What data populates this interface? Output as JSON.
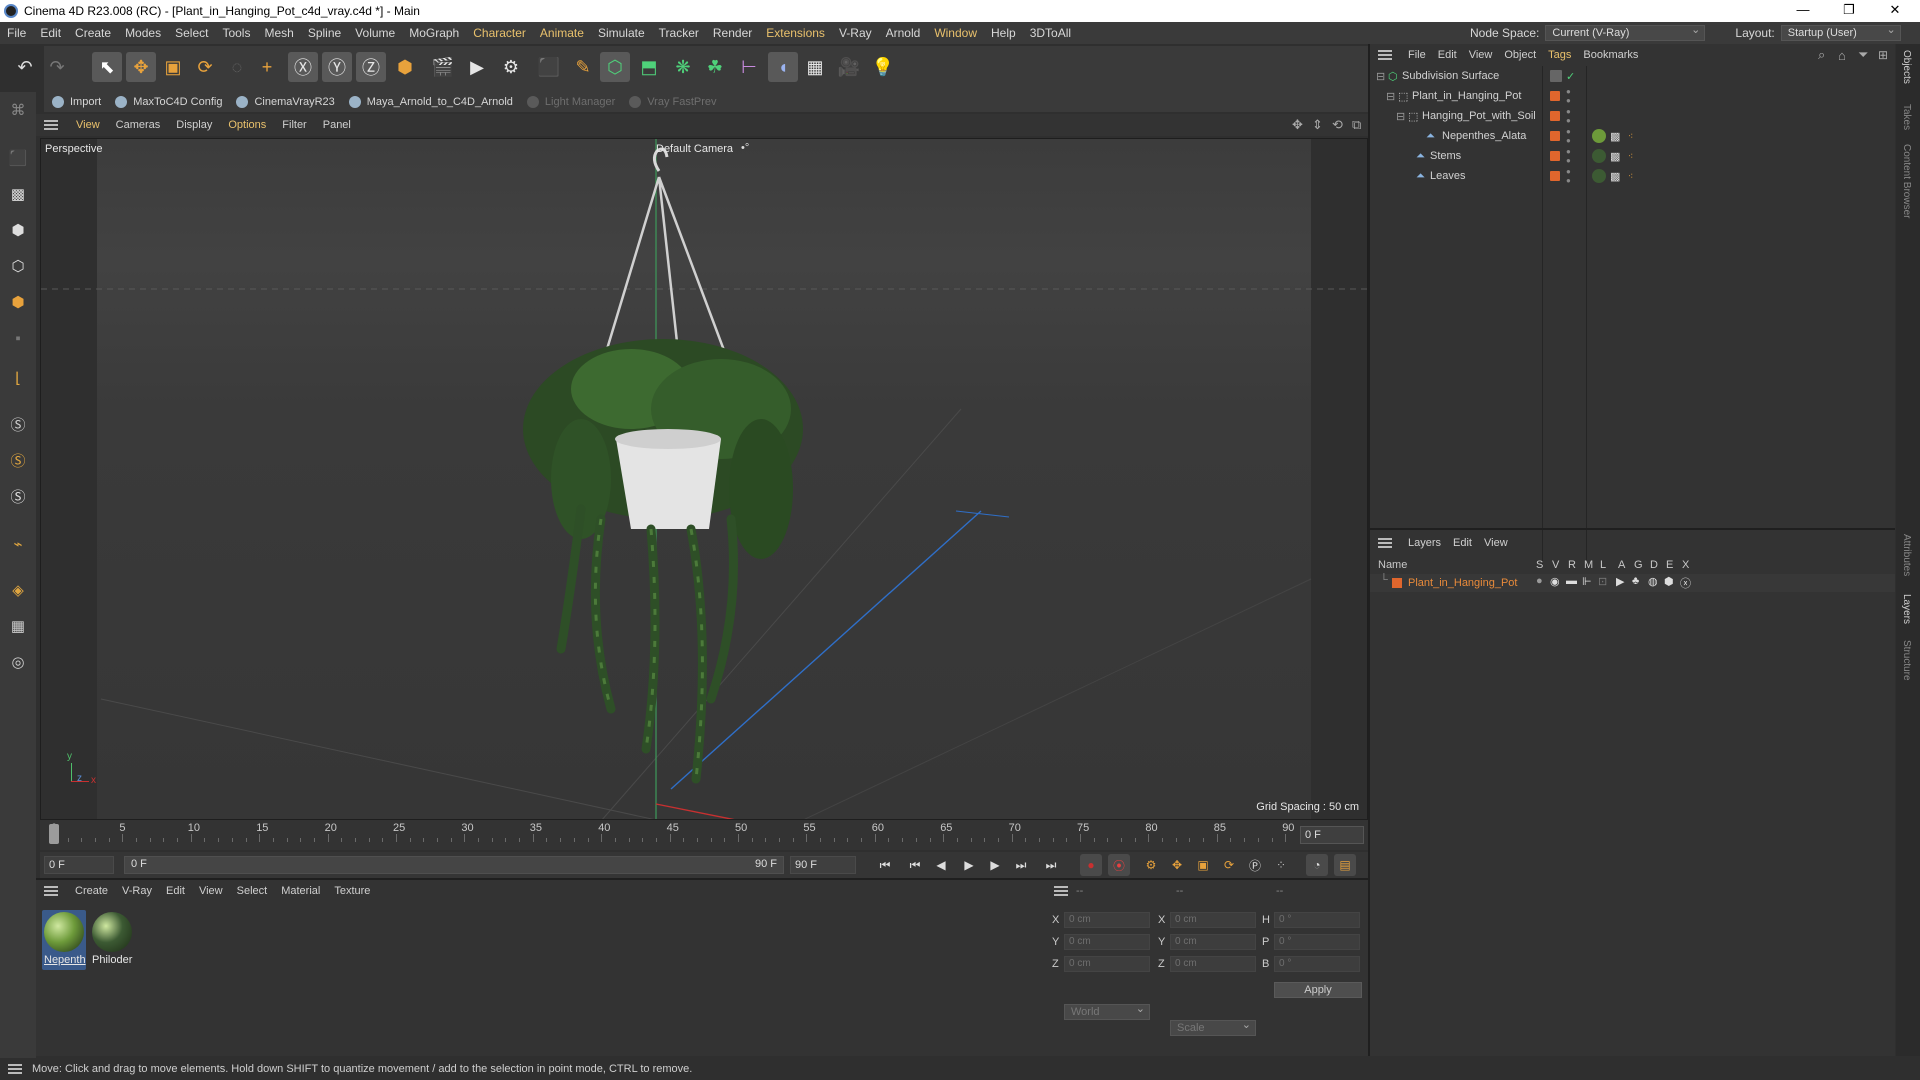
{
  "window": {
    "title": "Cinema 4D R23.008 (RC) - [Plant_in_Hanging_Pot_c4d_vray.c4d *] - Main",
    "minimize": "—",
    "restore": "❐",
    "close": "✕"
  },
  "menubar": {
    "items": [
      "File",
      "Edit",
      "Create",
      "Modes",
      "Select",
      "Tools",
      "Mesh",
      "Spline",
      "Volume",
      "MoGraph",
      "Character",
      "Animate",
      "Simulate",
      "Tracker",
      "Render",
      "Extensions",
      "V-Ray",
      "Arnold",
      "Window",
      "Help",
      "3DToAll"
    ],
    "node_space_label": "Node Space:",
    "node_space_value": "Current (V-Ray)",
    "layout_label": "Layout:",
    "layout_value": "Startup (User)"
  },
  "plugins": {
    "items": [
      "Import",
      "MaxToC4D Config",
      "CinemaVrayR23",
      "Maya_Arnold_to_C4D_Arnold",
      "Light Manager",
      "Vray FastPrev"
    ]
  },
  "viewport": {
    "menu": [
      "View",
      "Cameras",
      "Display",
      "Options",
      "Filter",
      "Panel"
    ],
    "label": "Perspective",
    "camera": "Default Camera",
    "camera_icon": "•°",
    "grid_spacing": "Grid Spacing : 50 cm",
    "axis_y": "y",
    "axis_x": "x",
    "axis_z": "z"
  },
  "timeline": {
    "ticks": [
      "0",
      "5",
      "10",
      "15",
      "20",
      "25",
      "30",
      "35",
      "40",
      "45",
      "50",
      "55",
      "60",
      "65",
      "70",
      "75",
      "80",
      "85",
      "90"
    ],
    "current_frame": "0 F"
  },
  "transport": {
    "start_field": "0 F",
    "range_start": "0 F",
    "range_end": "90 F",
    "end_field": "90 F"
  },
  "materials": {
    "menu": [
      "Create",
      "V-Ray",
      "Edit",
      "View",
      "Select",
      "Material",
      "Texture"
    ],
    "items": [
      {
        "label": "Nepenth",
        "color": "#6d9a3a"
      },
      {
        "label": "Philoder",
        "color": "#3c5a33"
      }
    ]
  },
  "coords": {
    "header1": "--",
    "header2": "--",
    "header3": "--",
    "rows": [
      {
        "a": "X",
        "av": "0 cm",
        "b": "X",
        "bv": "0 cm",
        "c": "H",
        "cv": "0 °"
      },
      {
        "a": "Y",
        "av": "0 cm",
        "b": "Y",
        "bv": "0 cm",
        "c": "P",
        "cv": "0 °"
      },
      {
        "a": "Z",
        "av": "0 cm",
        "b": "Z",
        "bv": "0 cm",
        "c": "B",
        "cv": "0 °"
      }
    ],
    "world": "World",
    "scale": "Scale",
    "apply": "Apply"
  },
  "objects": {
    "menu": [
      "File",
      "Edit",
      "View",
      "Object",
      "Tags",
      "Bookmarks"
    ],
    "tree": [
      {
        "name": "Subdivision Surface",
        "indent": 0
      },
      {
        "name": "Plant_in_Hanging_Pot",
        "indent": 1
      },
      {
        "name": "Hanging_Pot_with_Soil",
        "indent": 2
      },
      {
        "name": "Nepenthes_Alata",
        "indent": 3
      },
      {
        "name": "Stems",
        "indent": 2
      },
      {
        "name": "Leaves",
        "indent": 2
      }
    ]
  },
  "layers": {
    "menu": [
      "Layers",
      "Edit",
      "View"
    ],
    "columns": [
      "Name",
      "S",
      "V",
      "R",
      "M",
      "L",
      "A",
      "G",
      "D",
      "E",
      "X"
    ],
    "rows": [
      {
        "name": "Plant_in_Hanging_Pot"
      }
    ]
  },
  "sidetabs": [
    "Objects",
    "Takes",
    "Content Browser",
    "Attributes",
    "Layers",
    "Structure"
  ],
  "status": "Move: Click and drag to move elements. Hold down SHIFT to quantize movement / add to the selection in point mode, CTRL to remove.",
  "colors": {
    "accent": "#e0662d",
    "highlight": "#e9c16c",
    "layer_text": "#e88a3a"
  }
}
